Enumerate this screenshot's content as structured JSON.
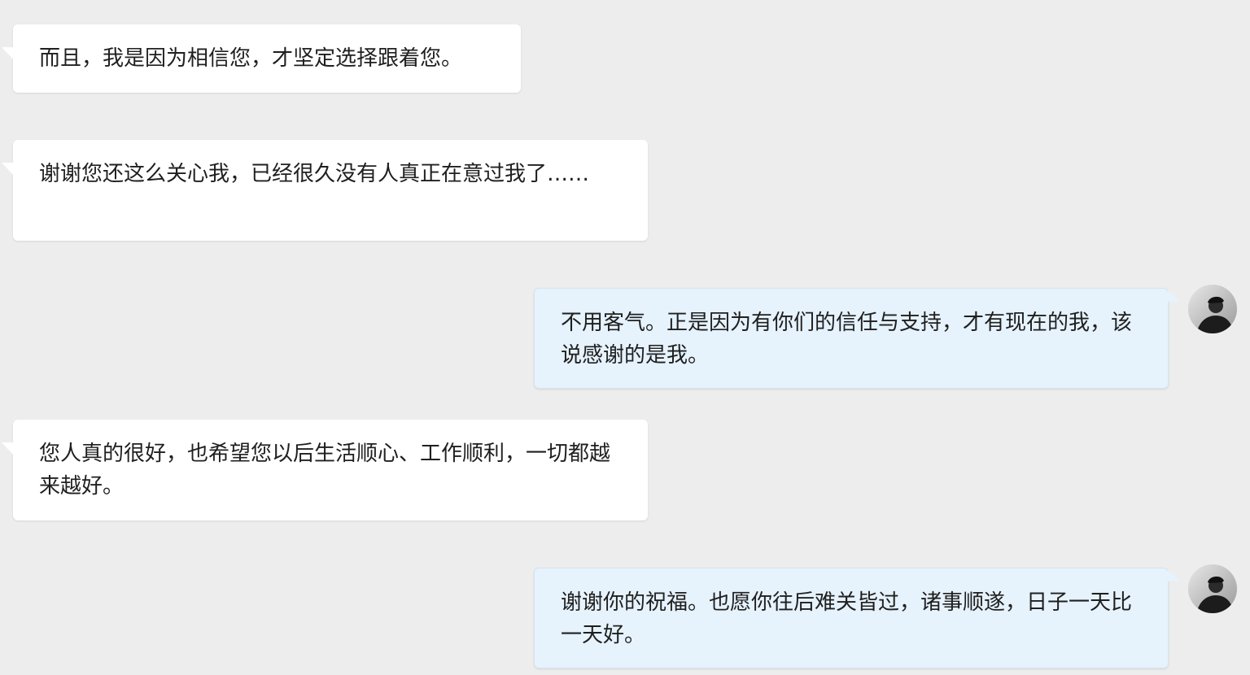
{
  "conversation": {
    "messages": [
      {
        "side": "left",
        "text": "而且，我是因为相信您，才坚定选择跟着您。"
      },
      {
        "side": "left",
        "text": "谢谢您还这么关心我，已经很久没有人真正在意过我了……"
      },
      {
        "side": "right",
        "text": "不用客气。正是因为有你们的信任与支持，才有现在的我，该说感谢的是我。"
      },
      {
        "side": "left",
        "text": "您人真的很好，也希望您以后生活顺心、工作顺利，一切都越来越好。"
      },
      {
        "side": "right",
        "text": "谢谢你的祝福。也愿你往后难关皆过，诸事顺遂，日子一天比一天好。"
      }
    ]
  },
  "colors": {
    "background": "#ededed",
    "incoming_bubble": "#ffffff",
    "outgoing_bubble": "#e6f2fc",
    "text": "#1f1f1f"
  },
  "icons": {
    "user_avatar": "avatar"
  }
}
